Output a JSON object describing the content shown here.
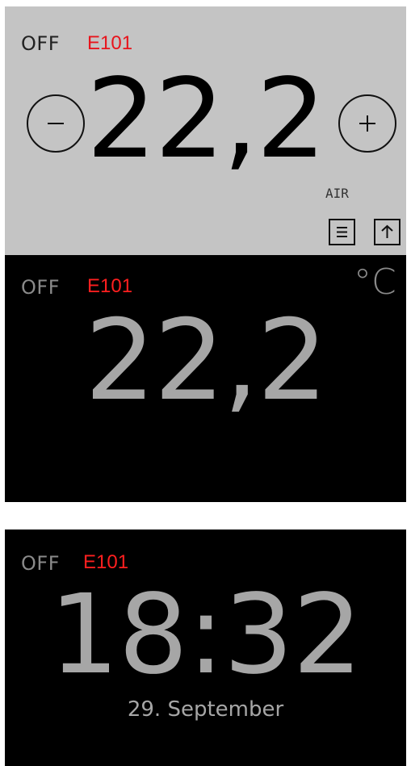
{
  "thermostat_active": {
    "mode": "OFF",
    "error": "E101",
    "temperature": "22,2",
    "sensor": "AIR",
    "minus_icon": "minus-icon",
    "plus_icon": "plus-icon",
    "menu_icon": "menu-icon",
    "arrow_icon": "arrow-up-icon",
    "background_color": "#c4c4c4"
  },
  "thermostat_idle": {
    "mode": "OFF",
    "error": "E101",
    "temperature": "22,2",
    "unit": "°C",
    "background_color": "#000000"
  },
  "clock_screen": {
    "mode": "OFF",
    "error": "E101",
    "time": "18:32",
    "date": "29. September",
    "background_color": "#000000"
  },
  "colors": {
    "error": "#e8141c",
    "dim_text": "#a6a6a6"
  }
}
